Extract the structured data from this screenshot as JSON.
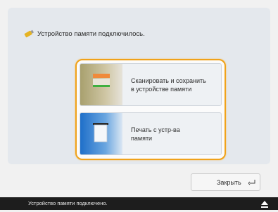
{
  "dialog": {
    "message": "Устройство памяти подключилось.",
    "message_icon": "usb-memory-icon",
    "options": [
      {
        "label": "Сканировать и сохранить\nв устройстве памяти",
        "icon": "scan-to-memory-icon"
      },
      {
        "label": "Печать с устр-ва\nпамяти",
        "icon": "print-from-memory-icon"
      }
    ],
    "highlight_color": "#f0a21a"
  },
  "close_button": {
    "label": "Закрыть",
    "icon": "enter-arrow-icon"
  },
  "status_bar": {
    "text": "Устройство памяти подключено.",
    "icon": "eject-icon"
  }
}
